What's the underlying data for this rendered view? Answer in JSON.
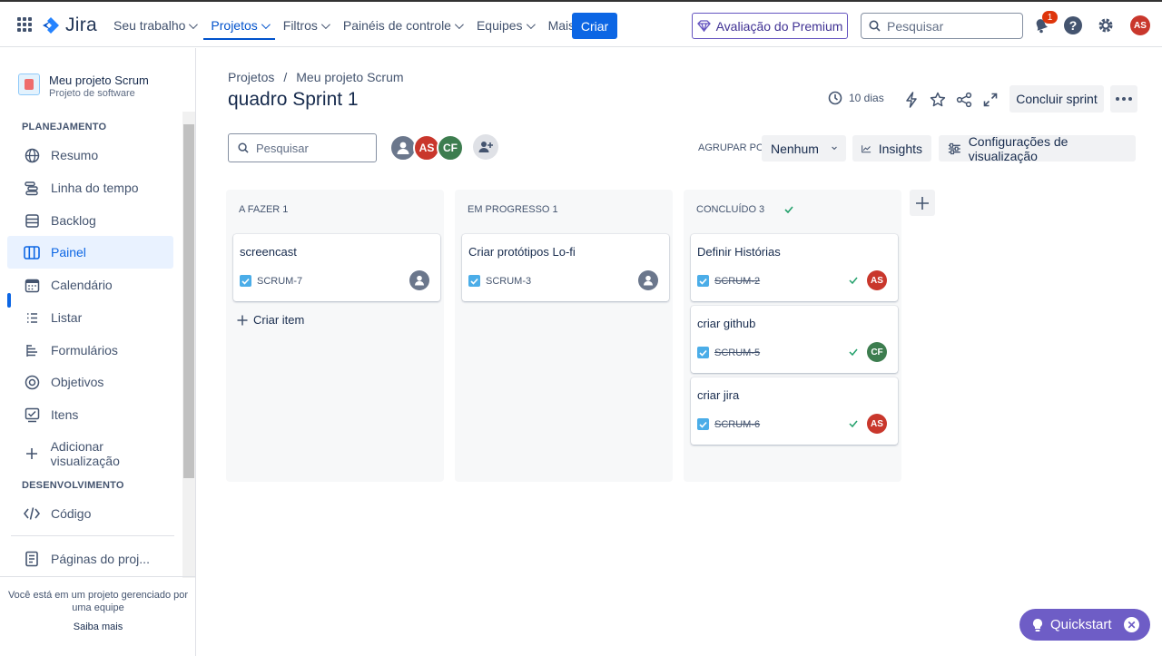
{
  "app": {
    "name": "Jira"
  },
  "nav": {
    "items": [
      {
        "label": "Seu trabalho"
      },
      {
        "label": "Projetos"
      },
      {
        "label": "Filtros"
      },
      {
        "label": "Painéis de controle"
      },
      {
        "label": "Equipes"
      },
      {
        "label": "Mais"
      }
    ],
    "create_label": "Criar",
    "premium_label": "Avaliação do Premium",
    "search_placeholder": "Pesquisar",
    "notifications_count": "1",
    "user_initials": "AS"
  },
  "sidebar": {
    "project_name": "Meu projeto Scrum",
    "project_type": "Projeto de software",
    "planning_title": "PLANEJAMENTO",
    "items": [
      {
        "label": "Resumo",
        "icon": "globe-icon"
      },
      {
        "label": "Linha do tempo",
        "icon": "timeline-icon"
      },
      {
        "label": "Backlog",
        "icon": "backlog-icon"
      },
      {
        "label": "Painel",
        "icon": "board-icon"
      },
      {
        "label": "Calendário",
        "icon": "calendar-icon"
      },
      {
        "label": "Listar",
        "icon": "list-icon"
      },
      {
        "label": "Formulários",
        "icon": "forms-icon"
      },
      {
        "label": "Objetivos",
        "icon": "target-icon"
      },
      {
        "label": "Itens",
        "icon": "items-icon"
      }
    ],
    "add_view_label": "Adicionar visualização",
    "dev_title": "DESENVOLVIMENTO",
    "code_label": "Código",
    "pages_label": "Páginas do proj...",
    "footer_text": "Você está em um projeto gerenciado por uma equipe",
    "learn_more": "Saiba mais"
  },
  "header": {
    "breadcrumb": [
      "Projetos",
      "/",
      "Meu projeto Scrum"
    ],
    "title": "quadro Sprint 1",
    "days_label": "10 dias",
    "complete_sprint_label": "Concluir sprint"
  },
  "toolbar": {
    "search_placeholder": "Pesquisar",
    "avatars": [
      "",
      "AS",
      "CF"
    ],
    "group_by_label": "AGRUPAR POR",
    "group_by_value": "Nenhum",
    "insights_label": "Insights",
    "view_settings_label": "Configurações de visualização"
  },
  "board": {
    "columns": [
      {
        "title": "A FAZER 1",
        "create_label": "Criar item",
        "cards": [
          {
            "title": "screencast",
            "key": "SCRUM-7",
            "assignee": ""
          }
        ]
      },
      {
        "title": "EM PROGRESSO 1",
        "cards": [
          {
            "title": "Criar protótipos Lo-fi",
            "key": "SCRUM-3",
            "assignee": ""
          }
        ]
      },
      {
        "title": "CONCLUÍDO 3",
        "cards": [
          {
            "title": "Definir Histórias",
            "key": "SCRUM-2",
            "assignee": "AS"
          },
          {
            "title": "criar github",
            "key": "SCRUM-5",
            "assignee": "CF"
          },
          {
            "title": "criar jira",
            "key": "SCRUM-6",
            "assignee": "AS"
          }
        ]
      }
    ]
  },
  "quickstart": {
    "label": "Quickstart"
  },
  "colors": {
    "brand": "#0c66e4",
    "premium": "#6554c0",
    "quickstart": "#6e5dc6"
  }
}
